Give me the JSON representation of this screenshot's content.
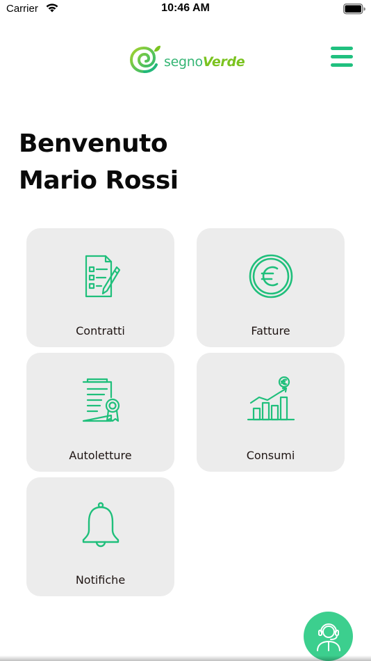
{
  "status_bar": {
    "carrier": "Carrier",
    "time": "10:46 AM",
    "icons": [
      "wifi-icon",
      "battery-icon"
    ]
  },
  "header": {
    "logo": {
      "part1": "segno",
      "part2": "Verde",
      "icon": "spiral-leaf-logo"
    },
    "menu_icon": "hamburger-menu-icon"
  },
  "welcome": {
    "greeting": "Benvenuto",
    "user_name": "Mario Rossi"
  },
  "tiles": [
    {
      "label": "Contratti",
      "icon": "contract-document-pen-icon"
    },
    {
      "label": "Fatture",
      "icon": "euro-circle-icon"
    },
    {
      "label": "Autoletture",
      "icon": "certificate-document-icon"
    },
    {
      "label": "Consumi",
      "icon": "bar-chart-euro-icon"
    },
    {
      "label": "Notifiche",
      "icon": "bell-icon"
    }
  ],
  "support_button": {
    "icon": "customer-support-headset-icon"
  },
  "colors": {
    "brand_green": "#20c07f",
    "logo_light_green": "#7bc320",
    "tile_background": "#ececec",
    "fab_background": "#3ccf8e",
    "icon_stroke": "#1fbf7b"
  }
}
